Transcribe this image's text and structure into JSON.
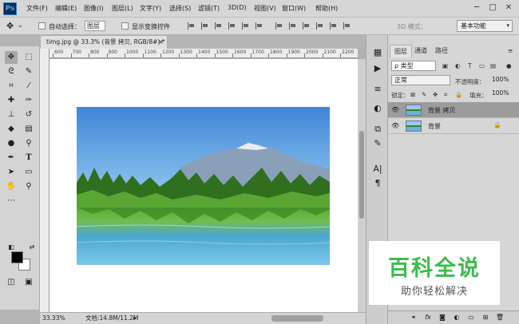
{
  "app": {
    "logo": "Ps"
  },
  "menu": [
    "文件(F)",
    "编辑(E)",
    "图像(I)",
    "图层(L)",
    "文字(Y)",
    "选择(S)",
    "滤镜(T)",
    "3D(D)",
    "视图(V)",
    "窗口(W)",
    "帮助(H)"
  ],
  "window_controls": {
    "minimize": "─",
    "restore": "□",
    "close": "✕"
  },
  "options": {
    "auto_select_label": "自动选择：",
    "layer_select_value": "图层",
    "transform_label": "显示变换控件",
    "mode_3d_label": "3D 模式：",
    "workspace": "基本功能"
  },
  "document": {
    "tab_title": "timg.jpg @ 33.3% (背景 拷贝, RGB/8#) *",
    "close_glyph": "×",
    "ruler_marks": [
      "600",
      "700",
      "800",
      "900",
      "1000",
      "1100",
      "1200",
      "1300",
      "1400",
      "1500",
      "1600",
      "1700",
      "1800",
      "1900",
      "2000",
      "2100",
      "2200"
    ]
  },
  "statusbar": {
    "zoom": "33.33%",
    "doc_info": "文档:14.8M/11.2M"
  },
  "layers_panel": {
    "tabs": [
      "图层",
      "通道",
      "路径"
    ],
    "filter_label": "ρ 类型",
    "blend_mode": "正常",
    "opacity_label": "不透明度：",
    "opacity_value": "100%",
    "lock_label": "锁定：",
    "fill_label": "填充：",
    "fill_value": "100%",
    "layers": [
      {
        "name": "背景 拷贝",
        "selected": true
      },
      {
        "name": "背景",
        "locked": true
      }
    ],
    "footer_icons": [
      "link-icon",
      "fx-icon",
      "mask-icon",
      "adjustment-icon",
      "group-icon",
      "new-layer-icon",
      "trash-icon"
    ]
  },
  "watermark": {
    "title": "百科全说",
    "subtitle": "助你轻松解决"
  },
  "colors": {
    "foreground": "#000000",
    "background": "#ffffff",
    "watermark_green": "#3bbc4b"
  }
}
